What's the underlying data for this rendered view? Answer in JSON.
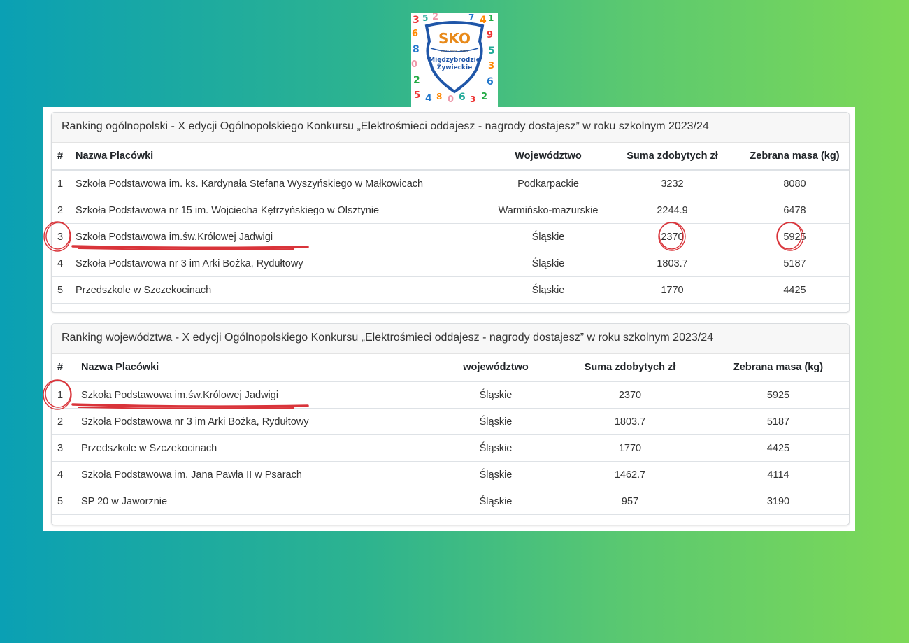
{
  "logo": {
    "brand": "SKO",
    "small": "PKO Bank Polski",
    "line1": "Międzybrodzie",
    "line2": "Żywieckie"
  },
  "national": {
    "title": "Ranking ogólnopolski - X edycji Ogólnopolskiego Konkursu „Elektrośmieci oddajesz - nagrody dostajesz” w roku szkolnym 2023/24",
    "headers": [
      "#",
      "Nazwa Placówki",
      "Województwo",
      "Suma zdobytych zł",
      "Zebrana masa (kg)"
    ],
    "rows": [
      [
        "1",
        "Szkoła Podstawowa im. ks. Kardynała Stefana Wyszyńskiego w Małkowicach",
        "Podkarpackie",
        "3232",
        "8080"
      ],
      [
        "2",
        "Szkoła Podstawowa nr 15 im. Wojciecha Kętrzyńskiego w Olsztynie",
        "Warmińsko-mazurskie",
        "2244.9",
        "6478"
      ],
      [
        "3",
        "Szkoła Podstawowa im.św.Królowej Jadwigi",
        "Śląskie",
        "2370",
        "5925"
      ],
      [
        "4",
        "Szkoła Podstawowa nr 3 im Arki Bożka, Rydułtowy",
        "Śląskie",
        "1803.7",
        "5187"
      ],
      [
        "5",
        "Przedszkole w Szczekocinach",
        "Śląskie",
        "1770",
        "4425"
      ]
    ]
  },
  "regional": {
    "title": "Ranking województwa - X edycji Ogólnopolskiego Konkursu „Elektrośmieci oddajesz - nagrody dostajesz” w roku szkolnym 2023/24",
    "headers": [
      "#",
      "Nazwa Placówki",
      "województwo",
      "Suma zdobytych zł",
      "Zebrana masa (kg)"
    ],
    "rows": [
      [
        "1",
        "Szkoła Podstawowa im.św.Królowej Jadwigi",
        "Śląskie",
        "2370",
        "5925"
      ],
      [
        "2",
        "Szkoła Podstawowa nr 3 im Arki Bożka, Rydułtowy",
        "Śląskie",
        "1803.7",
        "5187"
      ],
      [
        "3",
        "Przedszkole w Szczekocinach",
        "Śląskie",
        "1770",
        "4425"
      ],
      [
        "4",
        "Szkoła Podstawowa im. Jana Pawła II w Psarach",
        "Śląskie",
        "1462.7",
        "4114"
      ],
      [
        "5",
        "SP 20 w Jaworznie",
        "Śląskie",
        "957",
        "3190"
      ]
    ]
  },
  "colors": {
    "annotation": "#d9343a"
  }
}
